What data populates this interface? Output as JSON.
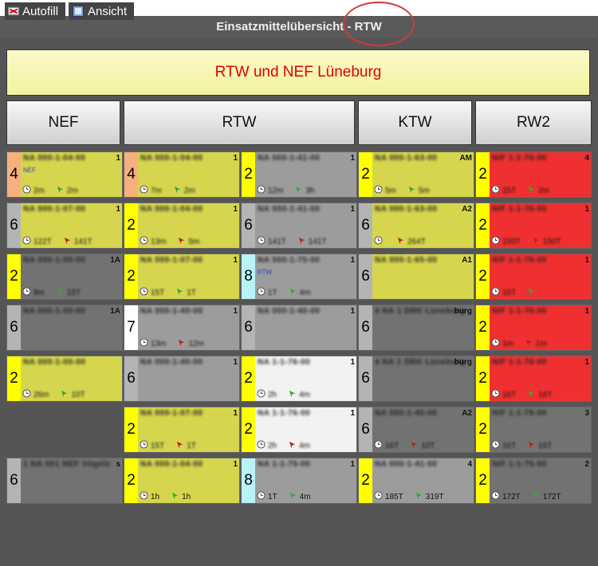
{
  "toolbar": {
    "autofill_label": "Autofill",
    "view_label": "Ansicht",
    "title": "Einsatzmittelübersicht - RTW"
  },
  "banner": "RTW und NEF Lüneburg",
  "columns": [
    {
      "label": "NEF"
    },
    {
      "label": "RTW"
    },
    {
      "label": "KTW"
    },
    {
      "label": "RW2"
    }
  ],
  "colors": {
    "yellow": "#d6d64e",
    "gray": "#9c9c9c",
    "dark": "#727272",
    "red": "#f03030",
    "white": "#f2f2f2",
    "stripe_orange": "#f6b07e",
    "stripe_yellow": "#ffff00",
    "stripe_cyan": "#b9f3f7",
    "stripe_white": "#ffffff",
    "stripe_gray": "#b4b4b4"
  },
  "cells": {
    "nef_1": {
      "num": "4",
      "name": "NA 000-1-04-00",
      "corner": "1",
      "tag": "NEF",
      "t1": "2m",
      "t2": "2m",
      "blur": true
    },
    "nef_2": {
      "num": "6",
      "name": "NA 000-1-07-00",
      "corner": "1",
      "t1": "122T",
      "t2": "141T",
      "blur": true
    },
    "nef_3": {
      "num": "2",
      "name": "NA 000-1-00-00",
      "corner": "1A",
      "t1": "8m",
      "t2": "15T",
      "blur": true
    },
    "nef_4": {
      "num": "6",
      "name": "NA 000-1-00-00",
      "corner": "1A",
      "t1": "",
      "t2": "",
      "blur": true
    },
    "nef_5": {
      "num": "2",
      "name": "NA 000-1-00-00",
      "corner": "",
      "t1": "26m",
      "t2": "10T",
      "blur": true
    },
    "nef_6": {
      "num": "6",
      "name": "1 NA 001 NEF Vögels",
      "corner": "s",
      "t1": "",
      "t2": "",
      "blur": true
    },
    "rtw_a1": {
      "num": "4",
      "name": "NA 000-1-04-00",
      "corner": "1",
      "t1": "7m",
      "t2": "2m",
      "blur": true
    },
    "rtw_a2": {
      "num": "2",
      "name": "NA 000-1-04-00",
      "corner": "1",
      "t1": "13m",
      "t2": "5m",
      "blur": true
    },
    "rtw_a3": {
      "num": "2",
      "name": "NA 000-1-07-00",
      "corner": "1",
      "t1": "15T",
      "t2": "1T",
      "blur": true
    },
    "rtw_a4": {
      "num": "7",
      "name": "NA 000-1-40-00",
      "corner": "1",
      "t1": "13m",
      "t2": "12m",
      "blur": true
    },
    "rtw_a5": {
      "num": "6",
      "name": "NA 000-1-40-00",
      "corner": "1",
      "t1": "",
      "t2": "",
      "blur": true
    },
    "rtw_a6": {
      "num": "2",
      "name": "NA 000-1-07-00",
      "corner": "1",
      "t1": "15T",
      "t2": "1T",
      "blur": true
    },
    "rtw_a7": {
      "num": "2",
      "name": "NA 000-1-04-00",
      "corner": "1",
      "t1": "1h",
      "t2": "1h",
      "blur": true,
      "sharp_times": true
    },
    "rtw_b1": {
      "num": "2",
      "name": "NA 000-1-41-00",
      "corner": "1",
      "t1": "12m",
      "t2": "3h",
      "blur": true
    },
    "rtw_b2": {
      "num": "6",
      "name": "NA 000-1-41-00",
      "corner": "1",
      "t1": "141T",
      "t2": "141T",
      "blur": true
    },
    "rtw_b3": {
      "num": "8",
      "name": "NA 000-1-75-00",
      "corner": "1",
      "tag": "RTW",
      "t1": "1T",
      "t2": "4m",
      "blur": true
    },
    "rtw_b4": {
      "num": "6",
      "name": "NA 000-1-40-00",
      "corner": "1",
      "t1": "",
      "t2": "",
      "blur": true
    },
    "rtw_b5": {
      "num": "2",
      "name": "NA 1-1-76-00",
      "corner": "1",
      "t1": "2h",
      "t2": "4m",
      "blur": true
    },
    "rtw_b6": {
      "num": "2",
      "name": "NA 1-1-76-00",
      "corner": "1",
      "t1": "2h",
      "t2": "4m",
      "blur": true
    },
    "rtw_b7": {
      "num": "8",
      "name": "NA 1-1-75-00",
      "corner": "1",
      "t1": "1T",
      "t2": "4m",
      "blur": true,
      "sharp_times": true
    },
    "ktw_1": {
      "num": "2",
      "name": "NA 000-1-63-00",
      "corner": "AM",
      "t1": "5m",
      "t2": "5m",
      "blur": true
    },
    "ktw_2": {
      "num": "6",
      "name": "NA 000-1-63-00",
      "corner": "A2",
      "t1": "",
      "t2": "264T",
      "blur": true
    },
    "ktw_3": {
      "num": "6",
      "name": "NA 000-1-65-00",
      "corner": "A1",
      "t1": "",
      "t2": "",
      "blur": true
    },
    "ktw_4": {
      "num": "6",
      "name": "4 NA 1 DRK Lüneburg",
      "corner": "burg",
      "t1": "",
      "t2": "",
      "blur": true
    },
    "ktw_5": {
      "num": "6",
      "name": "4 NA 1 DRK Lüneburg",
      "corner": "burg",
      "t1": "",
      "t2": "",
      "blur": true
    },
    "ktw_6": {
      "num": "6",
      "name": "NA 000-1-40-00",
      "corner": "A2",
      "t1": "16T",
      "t2": "10T",
      "blur": true
    },
    "ktw_7": {
      "num": "2",
      "name": "NA 000-1-41-00",
      "corner": "4",
      "t1": "185T",
      "t2": "319T",
      "blur": true,
      "sharp_times": true
    },
    "rw2_1": {
      "num": "2",
      "name": "NIF 1-1-76-00",
      "corner": "4",
      "t1": "25T",
      "t2": "2m",
      "blur": true
    },
    "rw2_2": {
      "num": "2",
      "name": "NIF 1-1-76-00",
      "corner": "1",
      "t1": "150T",
      "t2": "150T",
      "blur": true
    },
    "rw2_3": {
      "num": "2",
      "name": "NIF 1-1-76-00",
      "corner": "1",
      "t1": "15T",
      "t2": "",
      "blur": true
    },
    "rw2_4": {
      "num": "2",
      "name": "NIF 1-1-76-00",
      "corner": "1",
      "t1": "1m",
      "t2": "1m",
      "blur": true
    },
    "rw2_5": {
      "num": "2",
      "name": "NIF 1-1-76-00",
      "corner": "1",
      "t1": "16T",
      "t2": "16T",
      "blur": true
    },
    "rw2_6": {
      "num": "2",
      "name": "NIF 1-1-76-00",
      "corner": "3",
      "t1": "16T",
      "t2": "16T",
      "blur": true
    },
    "rw2_7": {
      "num": "2",
      "name": "NIF 1-1-76-00",
      "corner": "2",
      "t1": "172T",
      "t2": "172T",
      "blur": true,
      "sharp_times": true
    }
  }
}
